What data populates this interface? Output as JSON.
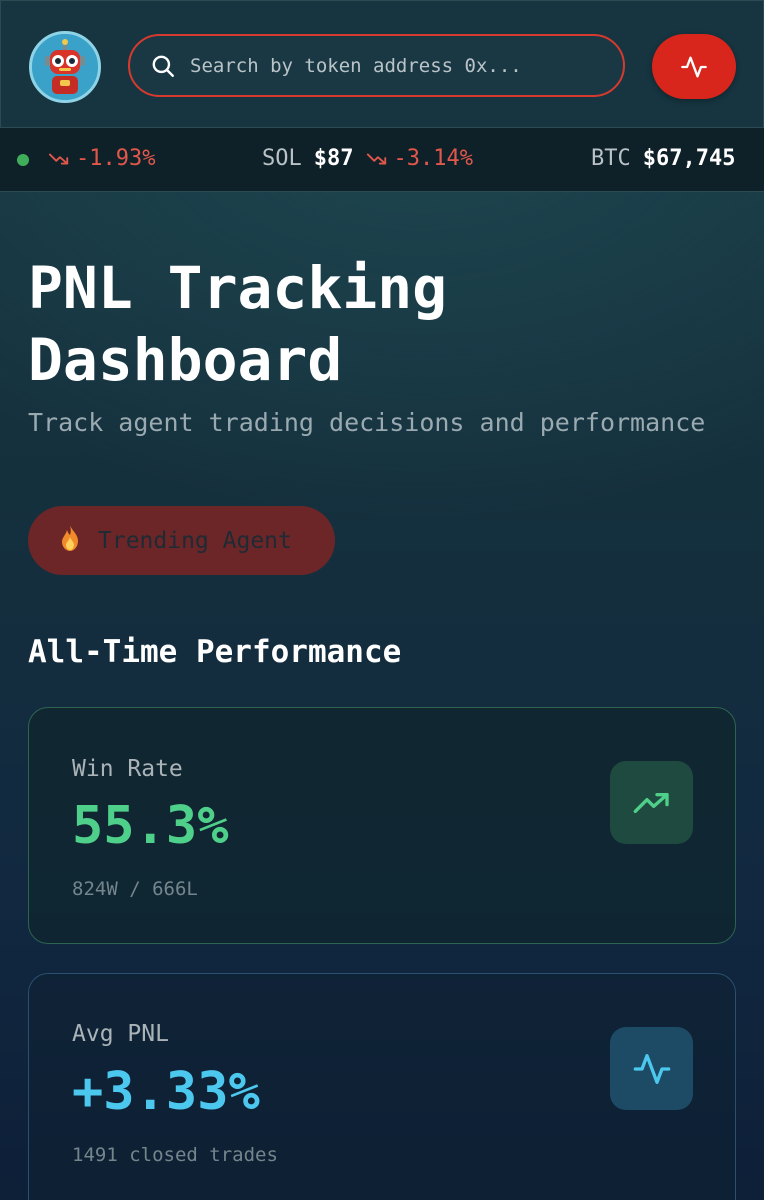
{
  "header": {
    "avatar_icon": "robot-avatar-icon",
    "search": {
      "placeholder": "Search by token address 0x...",
      "icon": "search-icon"
    },
    "activity_button_icon": "pulse-icon",
    "colors": {
      "accent": "#d8261c",
      "border": "#d63a2f"
    }
  },
  "ticker": {
    "status_color": "#3fae5a",
    "items": [
      {
        "symbol": "",
        "price": "",
        "change": "-1.93%",
        "direction": "down"
      },
      {
        "symbol": "SOL",
        "price": "$87",
        "change": "-3.14%",
        "direction": "down"
      },
      {
        "symbol": "BTC",
        "price": "$67,745",
        "change": "",
        "direction": ""
      }
    ]
  },
  "hero": {
    "title": "PNL Tracking Dashboard",
    "subtitle": "Track agent trading decisions and performance",
    "badge": {
      "label": "Trending Agent",
      "icon": "flame-icon"
    }
  },
  "performance": {
    "section_title": "All-Time Performance",
    "cards": [
      {
        "label": "Win Rate",
        "value": "55.3%",
        "meta": "824W / 666L",
        "icon": "trending-up-icon",
        "color": "#4fd08a"
      },
      {
        "label": "Avg PNL",
        "value": "+3.33%",
        "meta": "1491 closed trades",
        "icon": "pulse-icon",
        "color": "#4cc8ef"
      }
    ]
  }
}
